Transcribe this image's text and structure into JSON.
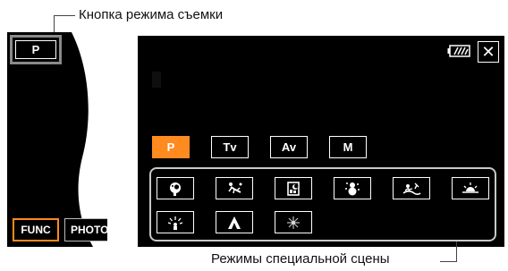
{
  "callouts": {
    "mode_button": "Кнопка режима съемки",
    "special_scenes": "Режимы специальной сцены"
  },
  "left_screen": {
    "mode_button_label": "P",
    "func_label": "FUNC",
    "photo_label": "PHOTO"
  },
  "main_screen": {
    "battery_icon": "battery-icon",
    "close_label": "✕",
    "modes": [
      {
        "label": "P",
        "active": true
      },
      {
        "label": "Tv",
        "active": false
      },
      {
        "label": "Av",
        "active": false
      },
      {
        "label": "M",
        "active": false
      }
    ],
    "scene_icons": [
      "portrait-icon",
      "sports-icon",
      "night-scene-icon",
      "snow-icon",
      "beach-icon",
      "sunset-icon",
      "spotlight-icon",
      "fireworks-icon",
      "low-light-icon"
    ]
  },
  "colors": {
    "accent": "#ff8a1f",
    "screen_bg": "#000000",
    "group_border": "#c8c8c8"
  }
}
